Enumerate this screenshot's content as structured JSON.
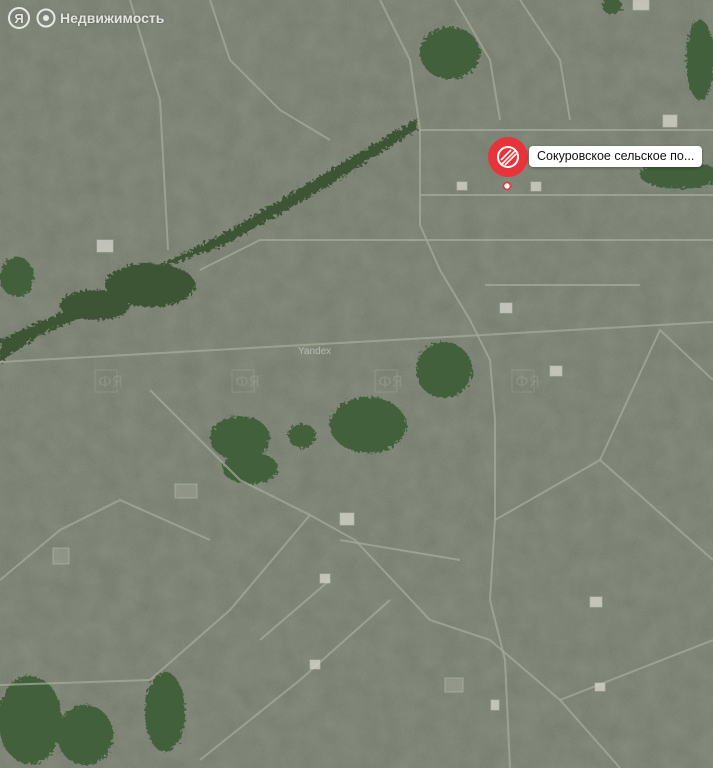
{
  "brand": {
    "logo_letter": "Я",
    "name": "Недвижимость",
    "logo_icon": "yandex-logo-icon",
    "mark_icon": "target-icon"
  },
  "map": {
    "watermark": "Yandex",
    "watermark_stamp": "ФЯ",
    "type": "satellite",
    "colors": {
      "field": "#6b7262",
      "tree": "#3f5a36",
      "road": "#a6a89a",
      "pin": "#e8333a"
    }
  },
  "marker": {
    "label": "Сокуровское сельское по...",
    "icon": "map-pin-icon"
  }
}
